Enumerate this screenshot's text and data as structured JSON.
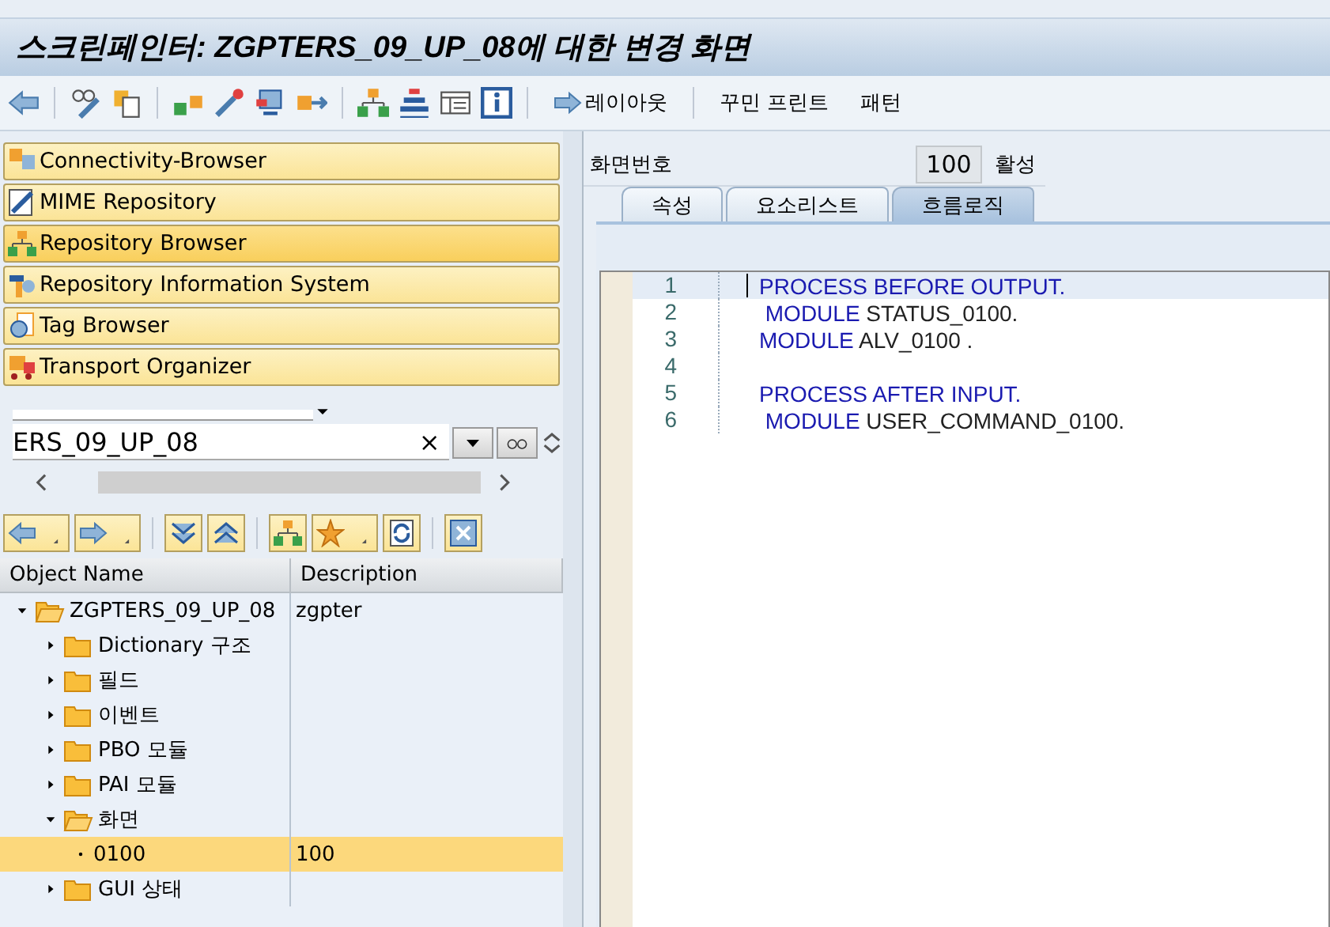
{
  "window": {
    "title": "스크린페인터: ZGPTERS_09_UP_08에 대한 변경 화면"
  },
  "toolbar": {
    "text_buttons": [
      "레이아웃",
      "꾸민 프린트",
      "패턴"
    ]
  },
  "navigator": [
    {
      "label": "Connectivity-Browser",
      "selected": false
    },
    {
      "label": "MIME Repository",
      "selected": false
    },
    {
      "label": "Repository Browser",
      "selected": true
    },
    {
      "label": "Repository Information System",
      "selected": false
    },
    {
      "label": "Tag Browser",
      "selected": false
    },
    {
      "label": "Transport Organizer",
      "selected": false
    }
  ],
  "object_field": {
    "value": "ERS_09_UP_08",
    "clear": "×"
  },
  "tree": {
    "columns": [
      "Object Name",
      "Description"
    ],
    "rows": [
      {
        "name": "ZGPTERS_09_UP_08",
        "description": "zgpter",
        "expanded": true,
        "selected": false,
        "children": [
          {
            "name": "Dictionary 구조",
            "expanded": false,
            "selected": false
          },
          {
            "name": "필드",
            "expanded": false,
            "selected": false
          },
          {
            "name": "이벤트",
            "expanded": false,
            "selected": false
          },
          {
            "name": "PBO 모듈",
            "expanded": false,
            "selected": false
          },
          {
            "name": "PAI 모듈",
            "expanded": false,
            "selected": false
          },
          {
            "name": "화면",
            "expanded": true,
            "selected": false,
            "children": [
              {
                "name": "0100",
                "description": "100",
                "kind": "leaf",
                "selected": true
              }
            ]
          },
          {
            "name": "GUI 상태",
            "expanded": false,
            "selected": false
          }
        ]
      }
    ]
  },
  "screen": {
    "number_label": "화면번호",
    "number": "100",
    "status": "활성",
    "tabs": [
      {
        "label": "속성",
        "selected": false
      },
      {
        "label": "요소리스트",
        "selected": false
      },
      {
        "label": "흐름로직",
        "selected": true
      }
    ],
    "editor": {
      "lines": [
        {
          "number": "1",
          "keyword": "PROCESS BEFORE OUTPUT.",
          "current": true
        },
        {
          "number": "2",
          "keyword": " MODULE",
          "rest": " STATUS_0100.",
          "current": false
        },
        {
          "number": "3",
          "keyword": "MODULE",
          "rest": " ALV_0100 .",
          "current": false
        },
        {
          "number": "4",
          "current": false
        },
        {
          "number": "5",
          "keyword": "PROCESS AFTER INPUT.",
          "current": false
        },
        {
          "number": "6",
          "keyword": " MODULE",
          "rest": " USER_COMMAND_0100.",
          "current": false
        }
      ]
    }
  }
}
